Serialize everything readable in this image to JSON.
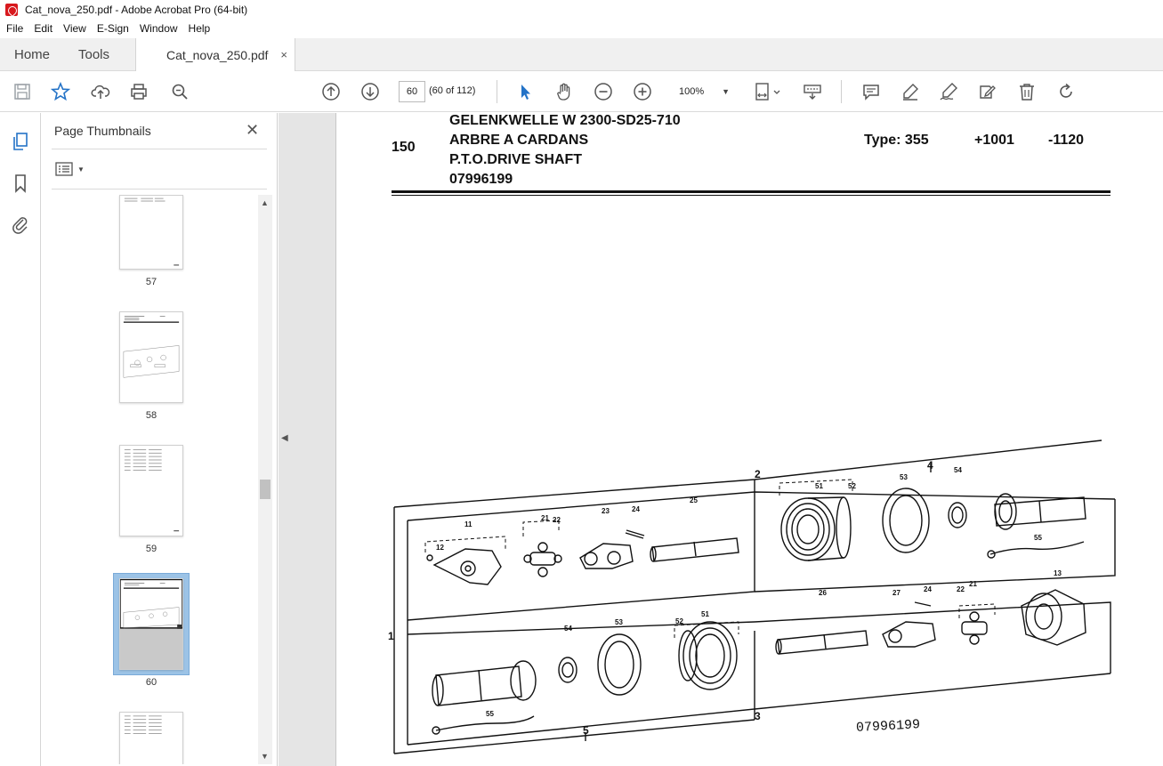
{
  "window": {
    "title": "Cat_nova_250.pdf - Adobe Acrobat Pro (64-bit)"
  },
  "menu": [
    "File",
    "Edit",
    "View",
    "E-Sign",
    "Window",
    "Help"
  ],
  "tabs": {
    "home": "Home",
    "tools": "Tools",
    "document": "Cat_nova_250.pdf",
    "close": "×"
  },
  "toolbar": {
    "page_value": "60",
    "page_count": "(60 of 112)",
    "zoom": "100%"
  },
  "panel": {
    "title": "Page Thumbnails",
    "close": "✕",
    "thumbnails": [
      {
        "label": "57",
        "selected": false
      },
      {
        "label": "58",
        "selected": false
      },
      {
        "label": "59",
        "selected": false
      },
      {
        "label": "60",
        "selected": true
      },
      {
        "label": "",
        "selected": false
      }
    ]
  },
  "document": {
    "item_no": "150",
    "title_de": "GELENKWELLE W 2300-SD25-710",
    "title_fr": "ARBRE A CARDANS",
    "title_en": "P.T.O.DRIVE SHAFT",
    "part_no": "07996199",
    "type": "Type: 355",
    "range_from": "+1001",
    "range_to": "-1120",
    "drawing_ref": "07996199",
    "callouts": [
      "1",
      "2",
      "3",
      "4",
      "5",
      "11",
      "12",
      "13",
      "21",
      "22",
      "23",
      "24",
      "25",
      "26",
      "27",
      "51",
      "52",
      "53",
      "54",
      "55"
    ]
  },
  "colors": {
    "accent": "#2473c7",
    "selection": "#9cc3e6",
    "pdf_red": "#d8191e"
  },
  "icons": [
    "save-icon",
    "star-icon",
    "upload-icon",
    "print-icon",
    "zoom-search-icon",
    "page-up-icon",
    "page-down-icon",
    "select-arrow-icon",
    "hand-icon",
    "zoom-out-icon",
    "zoom-in-icon",
    "fit-page-icon",
    "keyboard-icon",
    "comment-icon",
    "highlight-icon",
    "sign-icon",
    "redact-icon",
    "delete-icon",
    "rotate-icon"
  ]
}
